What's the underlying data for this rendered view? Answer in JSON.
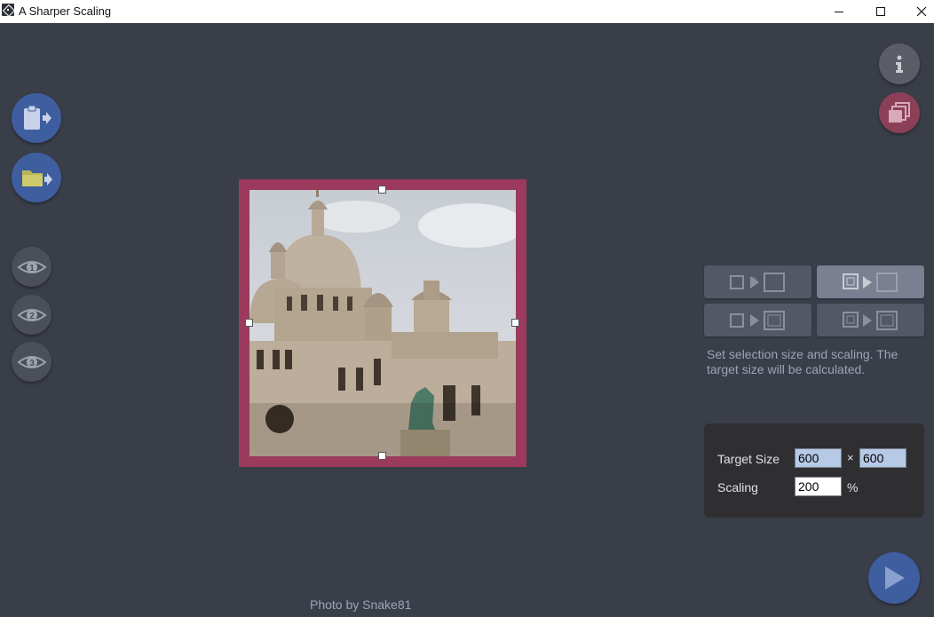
{
  "window": {
    "title": "A Sharper Scaling",
    "controls": {
      "minimize": "minimize-icon",
      "maximize": "maximize-icon",
      "close": "close-icon"
    }
  },
  "left_toolbar": {
    "buttons": [
      {
        "icon": "clipboard-import-icon"
      },
      {
        "icon": "folder-open-icon"
      }
    ],
    "view_buttons": [
      {
        "icon": "eye-icon",
        "label": "1"
      },
      {
        "icon": "eye-icon",
        "label": "2"
      },
      {
        "icon": "eye-icon",
        "label": "3"
      }
    ]
  },
  "top_right": {
    "info_icon": "info-icon",
    "stack_icon": "stack-copy-icon"
  },
  "preview": {
    "credit": "Photo by Snake81"
  },
  "modes": {
    "active_index": 1,
    "description": "Set selection size and scaling. The target size will be calculated."
  },
  "settings": {
    "target_size_label": "Target Size",
    "width": "600",
    "times": "×",
    "height": "600",
    "scaling_label": "Scaling",
    "scaling": "200",
    "unit": "%"
  },
  "run_icon": "play-icon",
  "colors": {
    "background": "#3a3e49",
    "accent_blue": "#3e5ea0",
    "frame_magenta": "#9b3a5d"
  }
}
